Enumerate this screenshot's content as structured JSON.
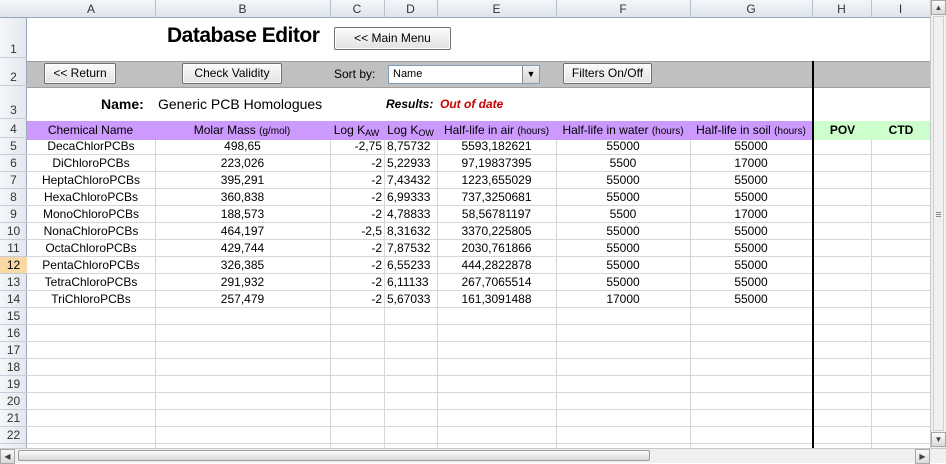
{
  "columns": [
    "A",
    "B",
    "C",
    "D",
    "E",
    "F",
    "G",
    "H",
    "I"
  ],
  "rows": [
    "1",
    "2",
    "3",
    "4",
    "5",
    "6",
    "7",
    "8",
    "9",
    "10",
    "11",
    "12",
    "13",
    "14",
    "15",
    "16",
    "17",
    "18",
    "19",
    "20",
    "21",
    "22"
  ],
  "selected_row": "12",
  "title": "Database Editor",
  "buttons": {
    "main_menu": "<< Main Menu",
    "return": "<< Return",
    "check_validity": "Check Validity",
    "filters": "Filters On/Off"
  },
  "sort": {
    "label": "Sort by:",
    "value": "Name"
  },
  "name_label": "Name:",
  "name_value": "Generic PCB Homologues",
  "results_label": "Results:",
  "results_value": "Out of date",
  "headers": {
    "chemical_name": "Chemical Name",
    "molar_mass": "Molar Mass",
    "molar_mass_unit": "(g/mol)",
    "log_kaw": "Log K",
    "log_kaw_sub": "AW",
    "log_kow": "Log K",
    "log_kow_sub": "OW",
    "hl_air": "Half-life in air",
    "hl_water": "Half-life in water",
    "hl_soil": "Half-life in soil",
    "hl_unit": "(hours)",
    "pov": "POV",
    "ctd": "CTD"
  },
  "table": [
    [
      "DecaChlorPCBs",
      "498,65",
      "-2,75",
      "8,75732",
      "5593,182621",
      "55000",
      "55000"
    ],
    [
      "DiChloroPCBs",
      "223,026",
      "-2",
      "5,22933",
      "97,19837395",
      "5500",
      "17000"
    ],
    [
      "HeptaChloroPCBs",
      "395,291",
      "-2",
      "7,43432",
      "1223,655029",
      "55000",
      "55000"
    ],
    [
      "HexaChloroPCBs",
      "360,838",
      "-2",
      "6,99333",
      "737,3250681",
      "55000",
      "55000"
    ],
    [
      "MonoChloroPCBs",
      "188,573",
      "-2",
      "4,78833",
      "58,56781197",
      "5500",
      "17000"
    ],
    [
      "NonaChloroPCBs",
      "464,197",
      "-2,5",
      "8,31632",
      "3370,225805",
      "55000",
      "55000"
    ],
    [
      "OctaChloroPCBs",
      "429,744",
      "-2",
      "7,87532",
      "2030,761866",
      "55000",
      "55000"
    ],
    [
      "PentaChloroPCBs",
      "326,385",
      "-2",
      "6,55233",
      "444,2822878",
      "55000",
      "55000"
    ],
    [
      "TetraChloroPCBs",
      "291,932",
      "-2",
      "6,11133",
      "267,7065514",
      "55000",
      "55000"
    ],
    [
      "TriChloroPCBs",
      "257,479",
      "-2",
      "5,67033",
      "161,3091488",
      "17000",
      "55000"
    ]
  ]
}
